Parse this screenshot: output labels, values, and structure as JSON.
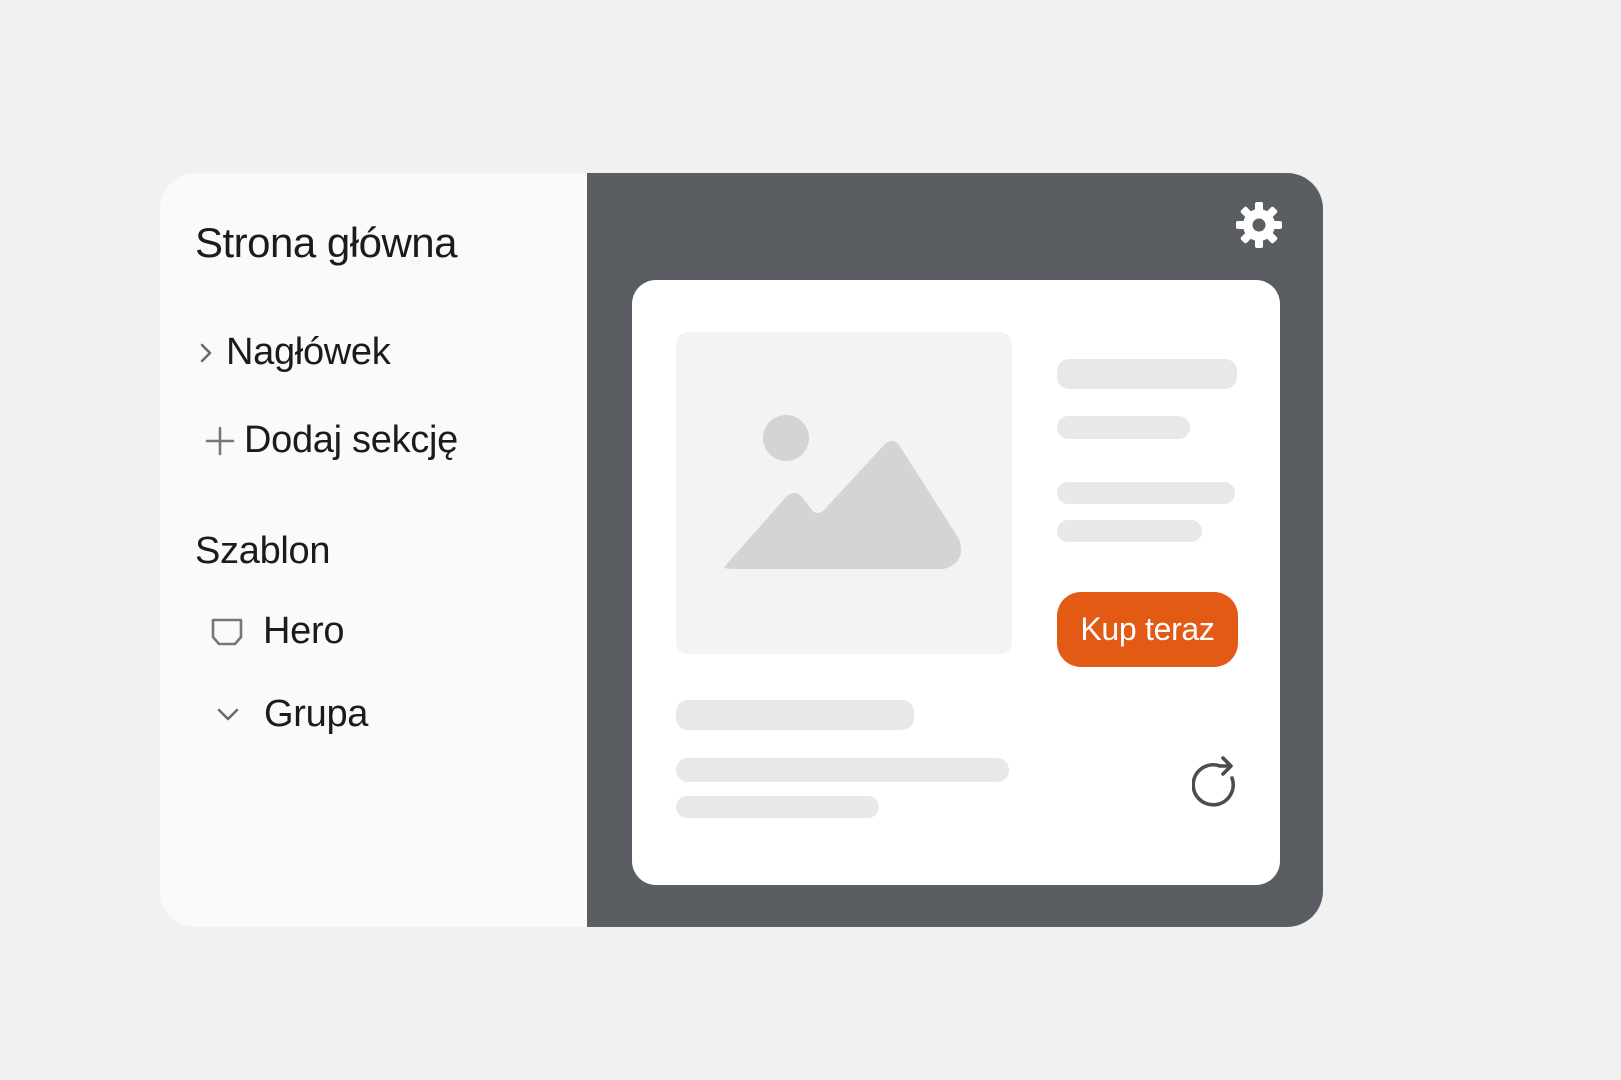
{
  "sidebar": {
    "page_title": "Strona główna",
    "items": [
      {
        "label": "Nagłówek",
        "icon": "chevron-right-icon"
      },
      {
        "label": "Dodaj sekcję",
        "icon": "plus-icon"
      }
    ],
    "template_section": {
      "title": "Szablon",
      "items": [
        {
          "label": "Hero",
          "icon": "hero-block-icon"
        },
        {
          "label": "Grupa",
          "icon": "chevron-down-icon"
        }
      ]
    }
  },
  "canvas": {
    "settings_icon": "gear-icon",
    "card": {
      "image_icon": "image-placeholder-icon",
      "cta_label": "Kup teraz",
      "refresh_icon": "refresh-icon"
    }
  },
  "colors": {
    "background": "#f1f1f1",
    "sidebar": "#fafafa",
    "canvas": "#5a5d62",
    "card": "#ffffff",
    "accent": "#e25a14",
    "placeholder": "#e8e8e8"
  }
}
